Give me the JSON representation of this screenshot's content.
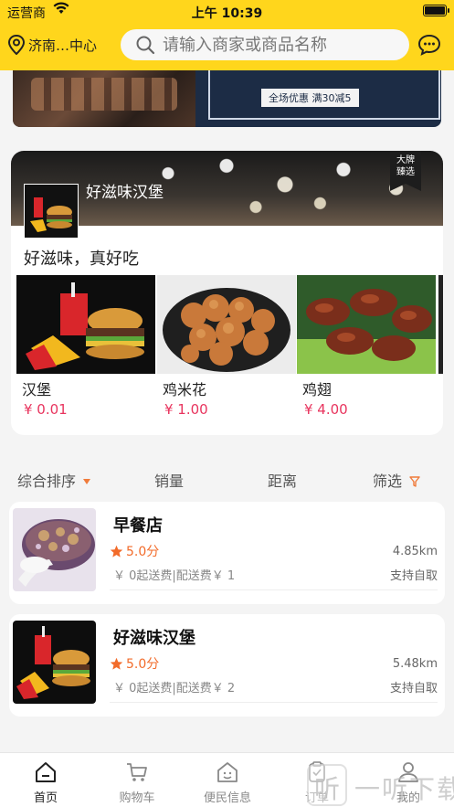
{
  "status_bar": {
    "carrier": "运营商",
    "time": "上午 10:39"
  },
  "header": {
    "location": "济南…中心",
    "search_placeholder": "请输入商家或商品名称",
    "icons": {
      "location": "location-pin-icon",
      "search": "search-icon",
      "message": "chat-bubble-icon"
    }
  },
  "banner": {
    "promo_text": "全场优惠 满30减5"
  },
  "featured": {
    "shop_name": "好滋味汉堡",
    "badge": "大牌\n臻选",
    "slogan": "好滋味，真好吃",
    "products": [
      {
        "name": "汉堡",
        "price": "¥ 0.01"
      },
      {
        "name": "鸡米花",
        "price": "¥ 1.00"
      },
      {
        "name": "鸡翅",
        "price": "¥ 4.00"
      }
    ]
  },
  "sort_bar": {
    "items": [
      "综合排序",
      "销量",
      "距离",
      "筛选"
    ]
  },
  "shops": [
    {
      "name": "早餐店",
      "rating": "5.0分",
      "distance": "4.85km",
      "fee": "￥ 0起送费|配送费￥ 1",
      "pickup": "支持自取"
    },
    {
      "name": "好滋味汉堡",
      "rating": "5.0分",
      "distance": "5.48km",
      "fee": "￥ 0起送费|配送费￥ 2",
      "pickup": "支持自取"
    }
  ],
  "tab_bar": {
    "items": [
      {
        "label": "首页",
        "icon": "home-icon"
      },
      {
        "label": "购物车",
        "icon": "cart-icon"
      },
      {
        "label": "便民信息",
        "icon": "info-house-icon"
      },
      {
        "label": "订单",
        "icon": "order-icon"
      },
      {
        "label": "我的",
        "icon": "profile-icon"
      }
    ]
  },
  "watermark": {
    "glyph": "听",
    "text": "一听下载"
  },
  "colors": {
    "header": "#FFD61C",
    "price": "#E8345E",
    "accent": "#F26B2A"
  }
}
